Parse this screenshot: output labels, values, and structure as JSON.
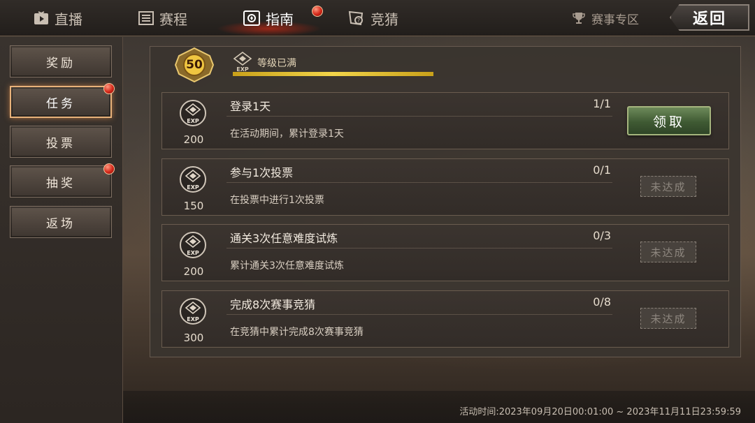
{
  "nav": {
    "tabs": [
      {
        "label": "直播",
        "icon": "play-icon"
      },
      {
        "label": "赛程",
        "icon": "list-icon"
      },
      {
        "label": "指南",
        "icon": "guide-icon"
      },
      {
        "label": "竞猜",
        "icon": "bet-icon"
      }
    ],
    "special_label": "赛事专区",
    "back_label": "返回"
  },
  "sidebar": {
    "items": [
      {
        "label": "奖励"
      },
      {
        "label": "任务"
      },
      {
        "label": "投票"
      },
      {
        "label": "抽奖"
      },
      {
        "label": "返场"
      }
    ]
  },
  "level": {
    "value": "50",
    "status": "等级已满",
    "exp_label": "EXP",
    "progress": 1.0
  },
  "tasks": [
    {
      "title": "登录1天",
      "progress": "1/1",
      "desc": "在活动期间，累计登录1天",
      "exp": "200",
      "action": "领取"
    },
    {
      "title": "参与1次投票",
      "progress": "0/1",
      "desc": "在投票中进行1次投票",
      "exp": "150",
      "action": "未达成"
    },
    {
      "title": "通关3次任意难度试炼",
      "progress": "0/3",
      "desc": "累计通关3次任意难度试炼",
      "exp": "200",
      "action": "未达成"
    },
    {
      "title": "完成8次赛事竞猜",
      "progress": "0/8",
      "desc": "在竞猜中累计完成8次赛事竞猜",
      "exp": "300",
      "action": "未达成"
    }
  ],
  "footer": {
    "activity_time": "活动时间:2023年09月20日00:01:00 ~ 2023年11月11日23:59:59"
  },
  "colors": {
    "accent_red": "#d5281a",
    "claim_green": "#3f5a33",
    "level_bar_gold": "#f2d54a"
  }
}
